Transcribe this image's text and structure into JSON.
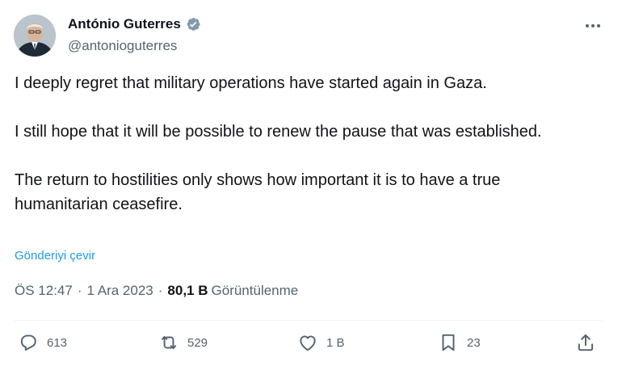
{
  "author": {
    "name": "António Guterres",
    "handle": "@antonioguterres"
  },
  "tweet": {
    "paragraphs": [
      "I deeply regret that military operations have started again in Gaza.",
      "I still hope that it will be possible to renew the pause that was established.",
      "The return to hostilities only shows how important it is to have a true humanitarian ceasefire."
    ],
    "translate_label": "Gönderiyi çevir",
    "time": "ÖS 12:47",
    "separator": "·",
    "date": "1 Ara 2023",
    "views_count": "80,1 B",
    "views_label": "Görüntülenme"
  },
  "actions": {
    "replies": "613",
    "retweets": "529",
    "likes": "1 B",
    "bookmarks": "23"
  },
  "colors": {
    "accent": "#1d9bf0",
    "secondary_text": "#536471",
    "primary_text": "#0f1419"
  }
}
